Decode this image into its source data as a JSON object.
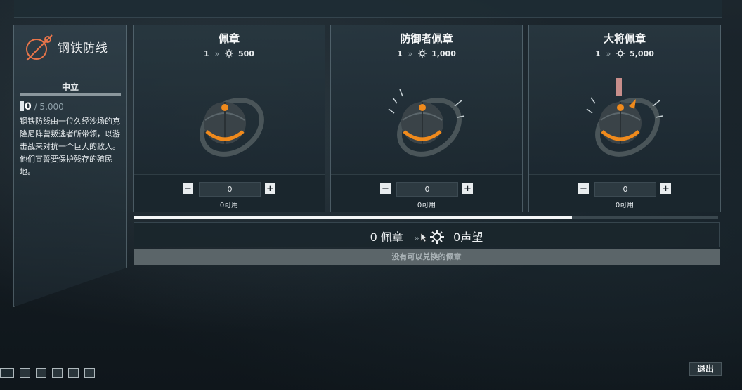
{
  "syndicate": {
    "name": "钢铁防线",
    "rank_title": "中立",
    "standing_current": "0",
    "standing_max": "/ 5,000",
    "description": "钢铁防线由一位久经沙场的克隆尼阵营叛逃者所带领，以游击战来对抗一个巨大的敌人。他们宣誓要保护残存的殖民地。"
  },
  "medallions": [
    {
      "name": "佩章",
      "qty": "1",
      "arrow": "»",
      "standing": "500",
      "field_value": "0",
      "available": "0可用"
    },
    {
      "name": "防御者佩章",
      "qty": "1",
      "arrow": "»",
      "standing": "1,000",
      "field_value": "0",
      "available": "0可用"
    },
    {
      "name": "大将佩章",
      "qty": "1",
      "arrow": "»",
      "standing": "5,000",
      "field_value": "0",
      "available": "0可用"
    }
  ],
  "controls": {
    "minus": "−",
    "plus": "+"
  },
  "progress": {
    "fill_fraction": 0.75
  },
  "summary": {
    "count": "0",
    "medal_label": "佩章",
    "arrow": "»",
    "standing_label": "0声望"
  },
  "exchange_message": "没有可以兑换的佩章",
  "exit_label": "退出",
  "colors": {
    "accent_orange": "#f08a1c",
    "emblem_orange": "#e8754a",
    "panel_border": "#8296a0"
  },
  "icons": {
    "standing": "standing-gear-icon",
    "arrow": "double-chevron-icon",
    "syndicate": "steel-meridian-emblem-icon"
  }
}
